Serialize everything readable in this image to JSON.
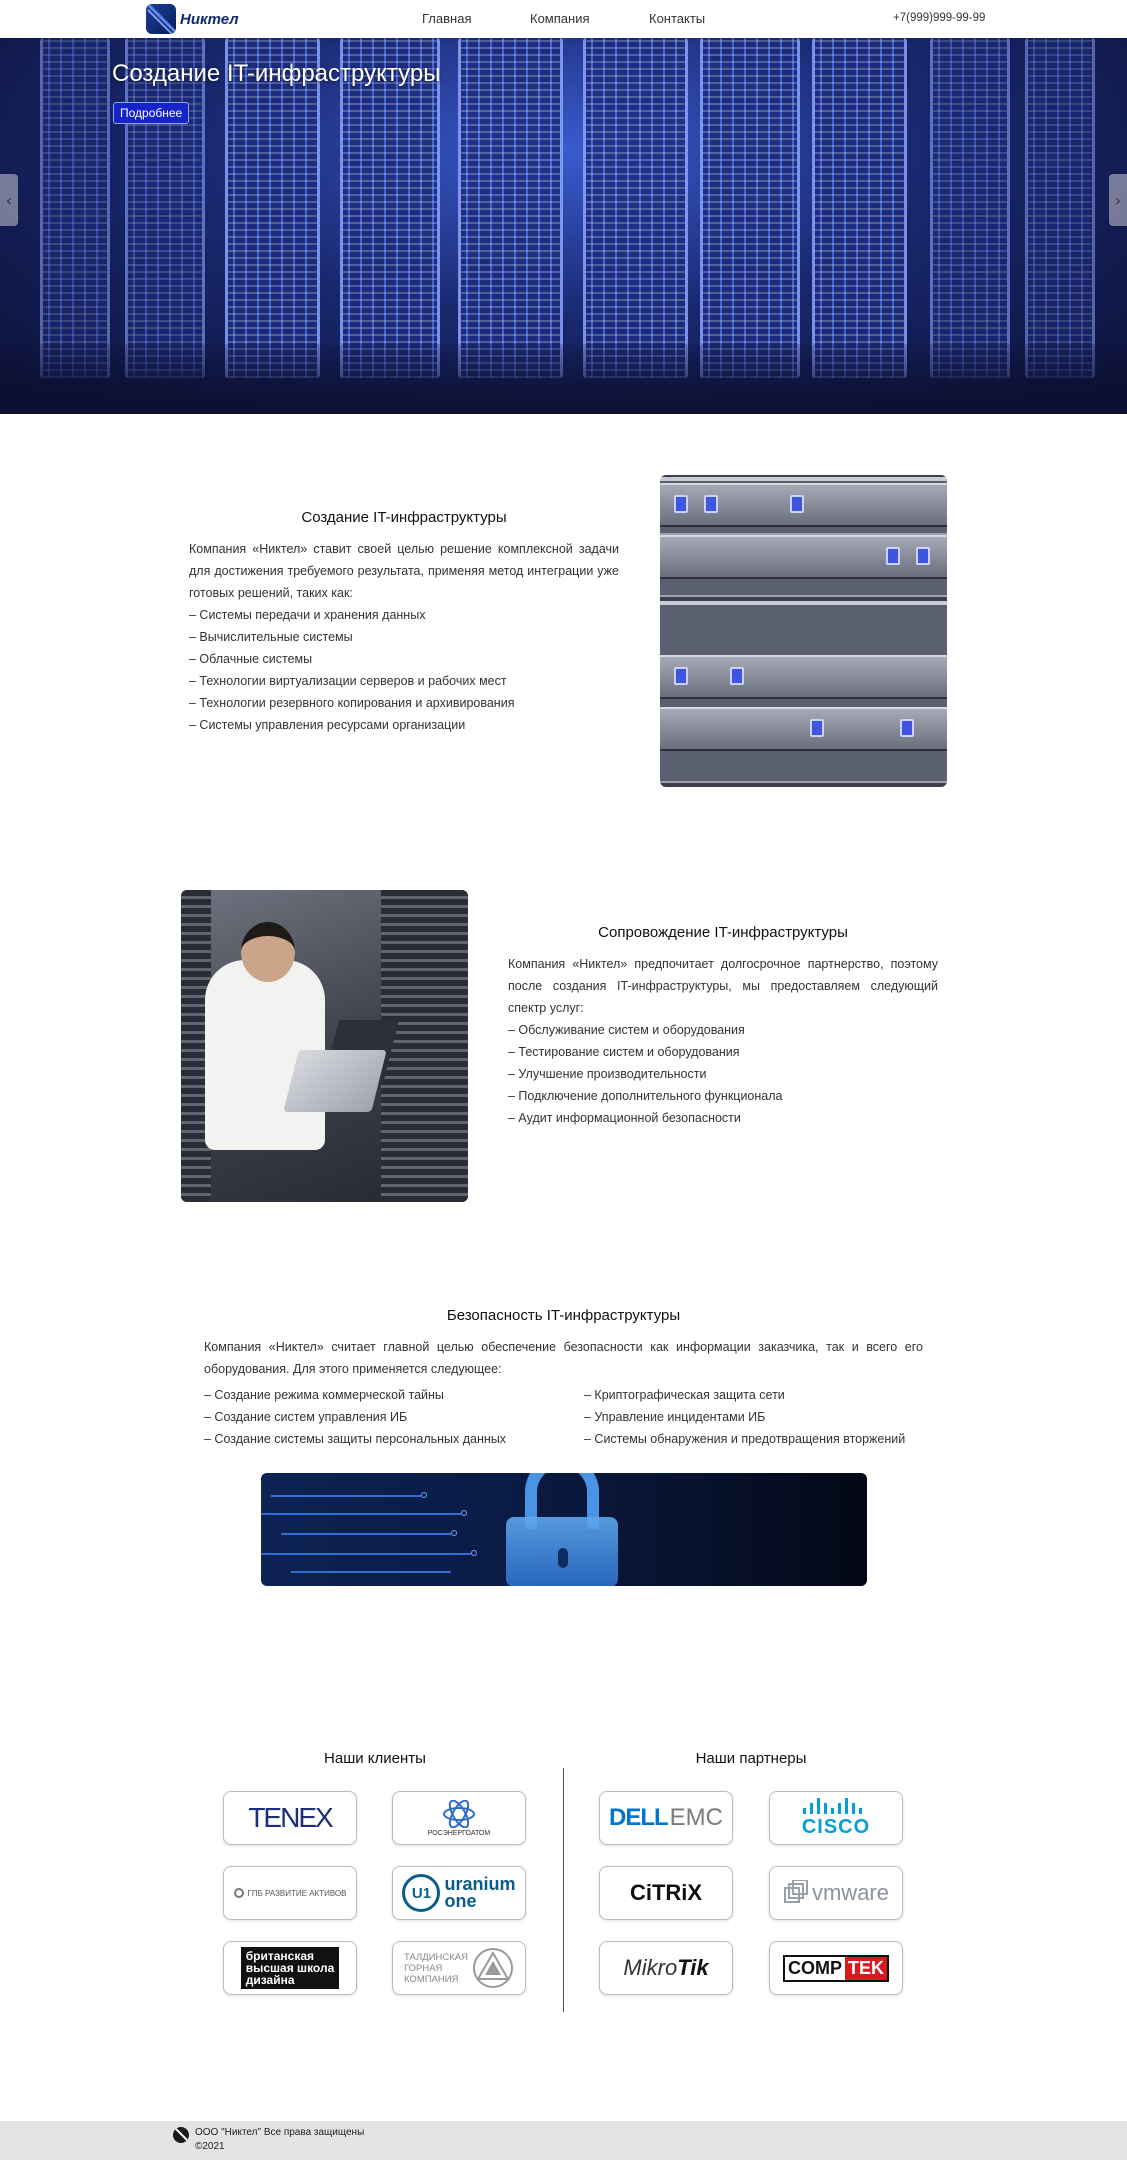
{
  "header": {
    "logo_text": "Никтел",
    "nav": {
      "home": "Главная",
      "company": "Компания",
      "contacts": "Контакты"
    },
    "phone": "+7(999)999-99-99"
  },
  "hero": {
    "title": "Создание IT-инфраструктуры",
    "button": "Подробнее",
    "arrow_left": "‹",
    "arrow_right": "›"
  },
  "section_create": {
    "title": "Создание IT-инфраструктуры",
    "intro": "Компания «Никтел» ставит своей целью решение комплексной задачи для достижения требуемого результата, применяя метод интеграции уже готовых решений, таких как:",
    "items": [
      "– Системы передачи и хранения данных",
      "– Вычислительные системы",
      "– Облачные системы",
      "– Технологии виртуализации серверов и рабочих мест",
      "– Технологии резервного копирования и архивирования",
      "– Системы управления ресурсами организации"
    ]
  },
  "section_support": {
    "title": "Сопровождение IT-инфраструктуры",
    "intro": "Компания «Никтел» предпочитает долгосрочное партнерство, поэтому после создания IT-инфраструктуры, мы предоставляем следующий спектр услуг:",
    "items": [
      "– Обслуживание систем и оборудования",
      "– Тестирование систем и оборудования",
      "– Улучшение производительности",
      "– Подключение дополнительного функционала",
      "– Аудит информационной безопасности"
    ]
  },
  "section_security": {
    "title": "Безопасность IT-инфраструктуры",
    "intro": "Компания «Никтел» считает главной целью обеспечение безопасности как информации заказчика, так и всего его оборудования. Для этого применяется следующее:",
    "left_items": [
      "– Создание режима коммерческой тайны",
      "– Создание систем управления ИБ",
      "– Создание системы защиты персональных данных"
    ],
    "right_items": [
      "– Криптографическая защита сети",
      "– Управление инцидентами ИБ",
      "– Системы обнаружения и предотвращения вторжений"
    ]
  },
  "clients": {
    "title": "Наши клиенты",
    "logos": {
      "tenex": "TENEX",
      "rosenergoatom": "РОСЭНЕРГОАТОМ",
      "gpb": "ГПБ РАЗВИТИЕ АКТИВОВ",
      "uranium_one_a": "uranium",
      "uranium_one_b": "one",
      "uranium_mark": "U1",
      "bhsad_1": "британская",
      "bhsad_2": "высшая школа",
      "bhsad_3": "дизайна",
      "taldinsk_1": "ТАЛДИНСКАЯ",
      "taldinsk_2": "ГОРНАЯ",
      "taldinsk_3": "КОМПАНИЯ"
    }
  },
  "partners": {
    "title": "Наши партнеры",
    "logos": {
      "dell_a": "DELL",
      "dell_b": "EMC",
      "cisco": "CISCO",
      "citrix": "CiTRiX",
      "vmware": "vmware",
      "mikrotik_a": "Mikro",
      "mikrotik_b": "Tik",
      "comptek_a": "COMP",
      "comptek_b": "TEK"
    }
  },
  "footer": {
    "line1": "ООО \"Никтел\" Все права защищены",
    "line2": "©2021"
  },
  "colors": {
    "accent_blue": "#1424c8",
    "footer_bg": "#e4e4e4",
    "dell_blue": "#0076ce",
    "cisco_blue": "#049fd9",
    "comptek_red": "#d71920"
  }
}
